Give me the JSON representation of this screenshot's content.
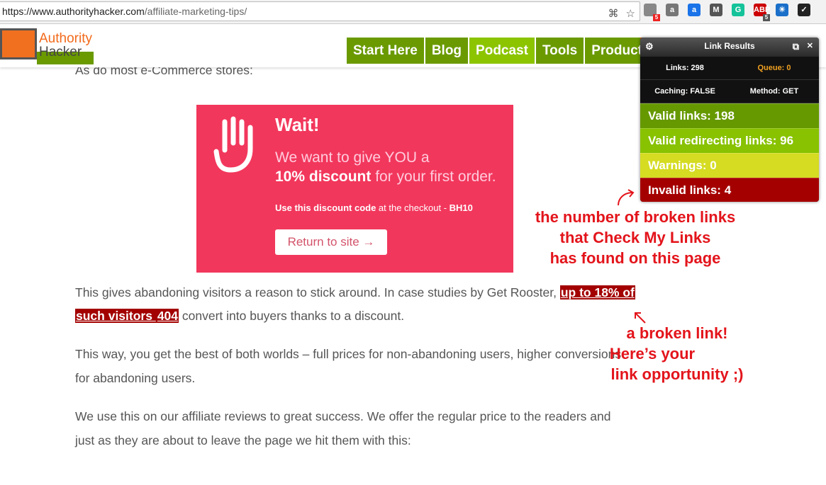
{
  "browser": {
    "url_host": "https://www.authorityhacker.com",
    "url_path": "/affiliate-marketing-tips/",
    "extensions": [
      {
        "name": "puzzle",
        "label": "",
        "color": "#888",
        "badge": "5",
        "badge_color": "#e22"
      },
      {
        "name": "bag",
        "label": "a",
        "color": "#777"
      },
      {
        "name": "a-circle",
        "label": "a",
        "color": "#1a73e8"
      },
      {
        "name": "m",
        "label": "M",
        "color": "#555"
      },
      {
        "name": "grammarly",
        "label": "G",
        "color": "#15c39a"
      },
      {
        "name": "adblock",
        "label": "ABP",
        "color": "#c00",
        "badge": "5",
        "badge_color": "#555"
      },
      {
        "name": "weather",
        "label": "☀",
        "color": "#1a6fc9"
      },
      {
        "name": "check",
        "label": "✓",
        "color": "#222"
      }
    ]
  },
  "site": {
    "logo_line1": "Authority",
    "logo_line2": "Hacker",
    "nav": [
      {
        "label": "Start Here"
      },
      {
        "label": "Blog"
      },
      {
        "label": "Podcast",
        "active": true
      },
      {
        "label": "Tools"
      },
      {
        "label": "Products"
      }
    ]
  },
  "article": {
    "intro": "As do most e-Commerce stores:",
    "popup": {
      "title": "Wait!",
      "line1": "We want to give YOU a",
      "bold": "10% discount",
      "line2": " for your first order.",
      "code_bold": "Use this discount code",
      "code_mid": " at the checkout - ",
      "code": "BH10",
      "button": "Return to site →"
    },
    "p1a": "This gives abandoning visitors a reason to stick around. In case studies by Get Rooster, ",
    "p1_link1": "up to 18% of",
    "p1_link2": "such visitors ",
    "p1_code": "404",
    "p1b": " convert into buyers thanks to a discount.",
    "p2a": "This way, you get the best of both worlds – full prices for non-abandoning users, higher conversions",
    "p2b": "for abandoning users.",
    "p3a": "We use this on our affiliate reviews to great success. We offer the regular price to the readers and",
    "p3b": "just as they are about to leave the page we hit them with this:"
  },
  "panel": {
    "title": "Link Results",
    "links": "Links: 298",
    "queue": "Queue: 0",
    "caching": "Caching: FALSE",
    "method": "Method: GET",
    "stats": [
      {
        "label": "Valid links: 198",
        "color": "#669900"
      },
      {
        "label": "Valid redirecting links: 96",
        "color": "#88c200"
      },
      {
        "label": "Warnings: 0",
        "color": "#d5dc22"
      },
      {
        "label": "Invalid links: 4",
        "color": "#a50000"
      }
    ]
  },
  "annotations": {
    "a1": [
      "the number of broken links",
      "that Check My Links",
      "has found on this page"
    ],
    "a2": [
      "a broken link!",
      "Here’s your",
      "link opportunity ;)"
    ]
  }
}
